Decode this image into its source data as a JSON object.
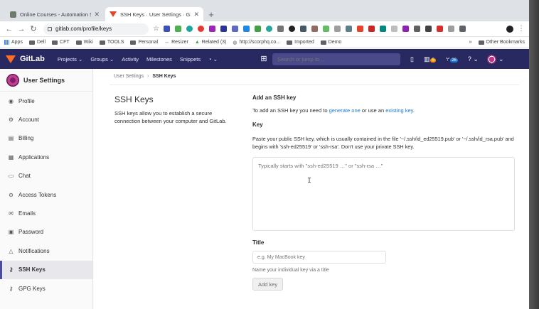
{
  "browser": {
    "tabs": [
      {
        "title": "Online Courses - Automation S",
        "active": false
      },
      {
        "title": "SSH Keys · User Settings · Git",
        "active": true
      }
    ],
    "new_tab": "+",
    "url": "gitlab.com/profile/keys",
    "bookmarks": [
      "Apps",
      "Dell",
      "CFT",
      "Wiki",
      "TOOLS",
      "Personal",
      "Resizer",
      "Related (3)",
      "http://scorphq.co...",
      "Imported",
      "Demo"
    ],
    "bookmarks_overflow": "»",
    "other_bookmarks": "Other Bookmarks"
  },
  "gitlab_nav": {
    "brand": "GitLab",
    "items": [
      "Projects ⌄",
      "Groups ⌄",
      "Activity",
      "Milestones",
      "Snippets"
    ],
    "search_placeholder": "Search or jump to…",
    "badges": {
      "issues": "5",
      "merge_requests": "26"
    },
    "help": "? ⌄"
  },
  "sidebar": {
    "title": "User Settings",
    "items": [
      {
        "label": "Profile",
        "icon": "profile-icon"
      },
      {
        "label": "Account",
        "icon": "account-icon"
      },
      {
        "label": "Billing",
        "icon": "billing-icon"
      },
      {
        "label": "Applications",
        "icon": "applications-icon"
      },
      {
        "label": "Chat",
        "icon": "chat-icon"
      },
      {
        "label": "Access Tokens",
        "icon": "token-icon"
      },
      {
        "label": "Emails",
        "icon": "email-icon"
      },
      {
        "label": "Password",
        "icon": "lock-icon"
      },
      {
        "label": "Notifications",
        "icon": "bell-icon"
      },
      {
        "label": "SSH Keys",
        "icon": "key-icon",
        "active": true
      },
      {
        "label": "GPG Keys",
        "icon": "key-icon"
      }
    ]
  },
  "breadcrumb": {
    "parent": "User Settings",
    "current": "SSH Keys"
  },
  "main": {
    "title": "SSH Keys",
    "description": "SSH keys allow you to establish a secure connection between your computer and GitLab.",
    "add_heading": "Add an SSH key",
    "add_text_prefix": "To add an SSH key you need to ",
    "generate_link": "generate one",
    "add_text_mid": " or use an ",
    "existing_link": "existing key",
    "add_text_suffix": ".",
    "key_label": "Key",
    "key_hint": "Paste your public SSH key, which is usually contained in the file '~/.ssh/id_ed25519.pub' or '~/.ssh/id_rsa.pub' and begins with 'ssh-ed25519' or 'ssh-rsa'. Don't use your private SSH key.",
    "key_placeholder": "Typically starts with \"ssh-ed25519 …\" or \"ssh-rsa …\"",
    "title_label": "Title",
    "title_placeholder": "e.g. My MacBook key",
    "title_help": "Name your individual key via a title",
    "add_button": "Add key"
  },
  "colors": {
    "gitlab_nav_bg": "#292961",
    "link": "#1f78d1",
    "gitlab_orange": "#fc6d26"
  }
}
